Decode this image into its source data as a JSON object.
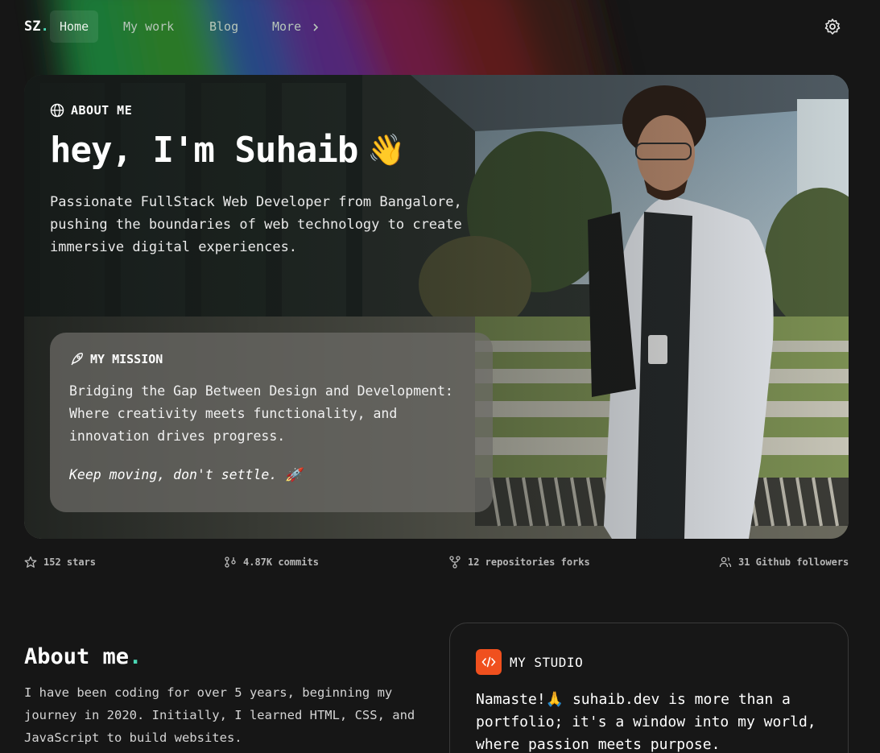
{
  "nav": {
    "logo": "SZ",
    "logo_dot": ".",
    "items": [
      {
        "label": "Home",
        "active": true
      },
      {
        "label": "My work"
      },
      {
        "label": "Blog"
      },
      {
        "label": "More"
      }
    ],
    "settings_icon": "gear-icon"
  },
  "hero": {
    "tag": "ABOUT ME",
    "tag_icon": "globe-icon",
    "title": "hey, I'm Suhaib",
    "title_emoji": "👋",
    "subtitle": "Passionate FullStack Web Developer from Bangalore, pushing the boundaries of web technology to create immersive digital experiences.",
    "mission": {
      "tag": "MY MISSION",
      "tag_icon": "rocket-icon",
      "text": "Bridging the Gap Between Design and Development: Where creativity meets functionality, and innovation drives progress.",
      "quote": "Keep moving, don't settle. 🚀"
    }
  },
  "stats": [
    {
      "icon": "star-icon",
      "label": "152 stars"
    },
    {
      "icon": "git-commit-icon",
      "label": "4.87K commits"
    },
    {
      "icon": "git-fork-icon",
      "label": "12 repositories forks"
    },
    {
      "icon": "users-icon",
      "label": "31 Github followers"
    }
  ],
  "about": {
    "heading": "About me",
    "heading_dot": ".",
    "text": "I have been coding for over 5 years, beginning my journey in 2020. Initially, I learned HTML, CSS, and JavaScript to build websites."
  },
  "studio": {
    "tag": "MY STUDIO",
    "icon": "code-icon",
    "text": "Namaste!🙏 suhaib.dev is more than a portfolio; it's a window into my world, where passion meets purpose."
  },
  "colors": {
    "accent": "#4ad7b4",
    "studio_icon_bg": "#f0501e",
    "background": "#161616"
  }
}
